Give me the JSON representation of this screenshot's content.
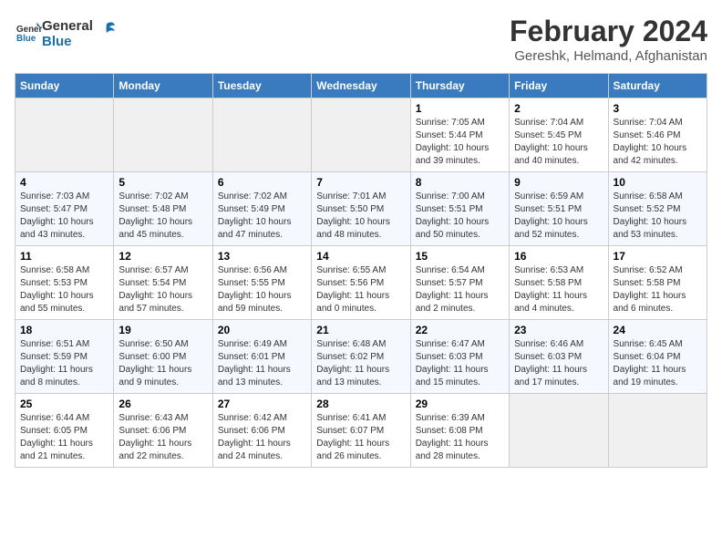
{
  "header": {
    "logo_line1": "General",
    "logo_line2": "Blue",
    "title": "February 2024",
    "subtitle": "Gereshk, Helmand, Afghanistan"
  },
  "weekdays": [
    "Sunday",
    "Monday",
    "Tuesday",
    "Wednesday",
    "Thursday",
    "Friday",
    "Saturday"
  ],
  "weeks": [
    [
      {
        "day": "",
        "content": ""
      },
      {
        "day": "",
        "content": ""
      },
      {
        "day": "",
        "content": ""
      },
      {
        "day": "",
        "content": ""
      },
      {
        "day": "1",
        "content": "Sunrise: 7:05 AM\nSunset: 5:44 PM\nDaylight: 10 hours\nand 39 minutes."
      },
      {
        "day": "2",
        "content": "Sunrise: 7:04 AM\nSunset: 5:45 PM\nDaylight: 10 hours\nand 40 minutes."
      },
      {
        "day": "3",
        "content": "Sunrise: 7:04 AM\nSunset: 5:46 PM\nDaylight: 10 hours\nand 42 minutes."
      }
    ],
    [
      {
        "day": "4",
        "content": "Sunrise: 7:03 AM\nSunset: 5:47 PM\nDaylight: 10 hours\nand 43 minutes."
      },
      {
        "day": "5",
        "content": "Sunrise: 7:02 AM\nSunset: 5:48 PM\nDaylight: 10 hours\nand 45 minutes."
      },
      {
        "day": "6",
        "content": "Sunrise: 7:02 AM\nSunset: 5:49 PM\nDaylight: 10 hours\nand 47 minutes."
      },
      {
        "day": "7",
        "content": "Sunrise: 7:01 AM\nSunset: 5:50 PM\nDaylight: 10 hours\nand 48 minutes."
      },
      {
        "day": "8",
        "content": "Sunrise: 7:00 AM\nSunset: 5:51 PM\nDaylight: 10 hours\nand 50 minutes."
      },
      {
        "day": "9",
        "content": "Sunrise: 6:59 AM\nSunset: 5:51 PM\nDaylight: 10 hours\nand 52 minutes."
      },
      {
        "day": "10",
        "content": "Sunrise: 6:58 AM\nSunset: 5:52 PM\nDaylight: 10 hours\nand 53 minutes."
      }
    ],
    [
      {
        "day": "11",
        "content": "Sunrise: 6:58 AM\nSunset: 5:53 PM\nDaylight: 10 hours\nand 55 minutes."
      },
      {
        "day": "12",
        "content": "Sunrise: 6:57 AM\nSunset: 5:54 PM\nDaylight: 10 hours\nand 57 minutes."
      },
      {
        "day": "13",
        "content": "Sunrise: 6:56 AM\nSunset: 5:55 PM\nDaylight: 10 hours\nand 59 minutes."
      },
      {
        "day": "14",
        "content": "Sunrise: 6:55 AM\nSunset: 5:56 PM\nDaylight: 11 hours\nand 0 minutes."
      },
      {
        "day": "15",
        "content": "Sunrise: 6:54 AM\nSunset: 5:57 PM\nDaylight: 11 hours\nand 2 minutes."
      },
      {
        "day": "16",
        "content": "Sunrise: 6:53 AM\nSunset: 5:58 PM\nDaylight: 11 hours\nand 4 minutes."
      },
      {
        "day": "17",
        "content": "Sunrise: 6:52 AM\nSunset: 5:58 PM\nDaylight: 11 hours\nand 6 minutes."
      }
    ],
    [
      {
        "day": "18",
        "content": "Sunrise: 6:51 AM\nSunset: 5:59 PM\nDaylight: 11 hours\nand 8 minutes."
      },
      {
        "day": "19",
        "content": "Sunrise: 6:50 AM\nSunset: 6:00 PM\nDaylight: 11 hours\nand 9 minutes."
      },
      {
        "day": "20",
        "content": "Sunrise: 6:49 AM\nSunset: 6:01 PM\nDaylight: 11 hours\nand 13 minutes."
      },
      {
        "day": "21",
        "content": "Sunrise: 6:48 AM\nSunset: 6:02 PM\nDaylight: 11 hours\nand 13 minutes."
      },
      {
        "day": "22",
        "content": "Sunrise: 6:47 AM\nSunset: 6:03 PM\nDaylight: 11 hours\nand 15 minutes."
      },
      {
        "day": "23",
        "content": "Sunrise: 6:46 AM\nSunset: 6:03 PM\nDaylight: 11 hours\nand 17 minutes."
      },
      {
        "day": "24",
        "content": "Sunrise: 6:45 AM\nSunset: 6:04 PM\nDaylight: 11 hours\nand 19 minutes."
      }
    ],
    [
      {
        "day": "25",
        "content": "Sunrise: 6:44 AM\nSunset: 6:05 PM\nDaylight: 11 hours\nand 21 minutes."
      },
      {
        "day": "26",
        "content": "Sunrise: 6:43 AM\nSunset: 6:06 PM\nDaylight: 11 hours\nand 22 minutes."
      },
      {
        "day": "27",
        "content": "Sunrise: 6:42 AM\nSunset: 6:06 PM\nDaylight: 11 hours\nand 24 minutes."
      },
      {
        "day": "28",
        "content": "Sunrise: 6:41 AM\nSunset: 6:07 PM\nDaylight: 11 hours\nand 26 minutes."
      },
      {
        "day": "29",
        "content": "Sunrise: 6:39 AM\nSunset: 6:08 PM\nDaylight: 11 hours\nand 28 minutes."
      },
      {
        "day": "",
        "content": ""
      },
      {
        "day": "",
        "content": ""
      }
    ]
  ]
}
